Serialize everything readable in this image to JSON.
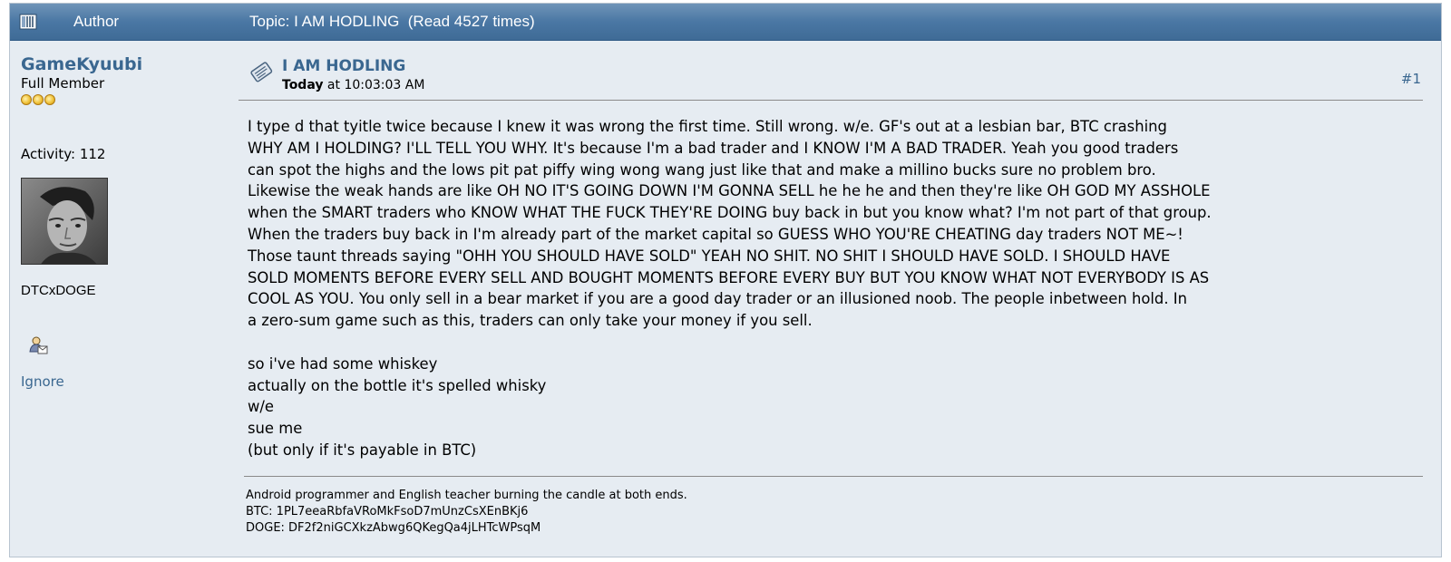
{
  "header": {
    "author_label": "Author",
    "topic_label": "Topic: I AM HODLING  (Read 4527 times)"
  },
  "poster": {
    "name": "GameKyuubi",
    "rank": "Full Member",
    "stars": 3,
    "activity": "Activity: 112",
    "personal_text": "DTCxDOGE",
    "ignore_label": "Ignore"
  },
  "post": {
    "subject": "I AM HODLING",
    "date_bold": "Today",
    "date_rest": " at 10:03:03 AM",
    "counter": "#1",
    "body_lines": [
      "I type d that tyitle twice because I knew it was wrong the first time.  Still wrong.  w/e.  GF's out at a lesbian bar, BTC crashing",
      "WHY AM I HOLDING? I'LL TELL YOU WHY.  It's because I'm a bad trader and I KNOW I'M A BAD TRADER.  Yeah you good traders",
      "can spot the highs and the lows pit pat piffy wing wong wang just like that and make a millino bucks sure no problem bro.",
      "Likewise the weak hands are like OH NO IT'S GOING DOWN I'M GONNA SELL he he he and then they're like OH GOD MY ASSHOLE",
      "when the SMART traders who KNOW WHAT THE FUCK THEY'RE DOING buy back in but you know what?  I'm not part of that group.",
      "When the traders buy back in I'm already part of the market capital so GUESS WHO YOU'RE CHEATING day traders NOT ME~!",
      "Those taunt threads saying \"OHH YOU SHOULD HAVE SOLD\" YEAH NO SHIT.  NO SHIT I SHOULD HAVE SOLD.  I SHOULD HAVE",
      "SOLD MOMENTS BEFORE EVERY SELL AND BOUGHT MOMENTS BEFORE EVERY BUY BUT YOU KNOW WHAT NOT EVERYBODY IS AS",
      "COOL AS YOU.  You only sell in a bear market if you are a good day trader or an illusioned noob.  The people inbetween hold.  In",
      "a zero-sum game such as this, traders can only take your money if you sell."
    ],
    "body_tail": [
      "so i've had some whiskey",
      "actually on the bottle it's spelled whisky",
      "w/e",
      "sue me",
      "(but only if it's payable in BTC)"
    ]
  },
  "signature": {
    "line1": "Android programmer and English teacher burning the candle at both ends.",
    "line2": "BTC: 1PL7eeaRbfaVRoMkFsoD7mUnzCsXEnBKj6",
    "line3": "DOGE: DF2f2niGCXkzAbwg6QKegQa4jLHTcWPsqM"
  },
  "icons": {
    "header": "topic-icon",
    "message": "message-icon",
    "pm": "personal-message-icon",
    "star": "star-icon"
  },
  "colors": {
    "link": "#3a6790",
    "header_bg": "#4a77a4",
    "panel_bg": "#e6ecf2"
  }
}
